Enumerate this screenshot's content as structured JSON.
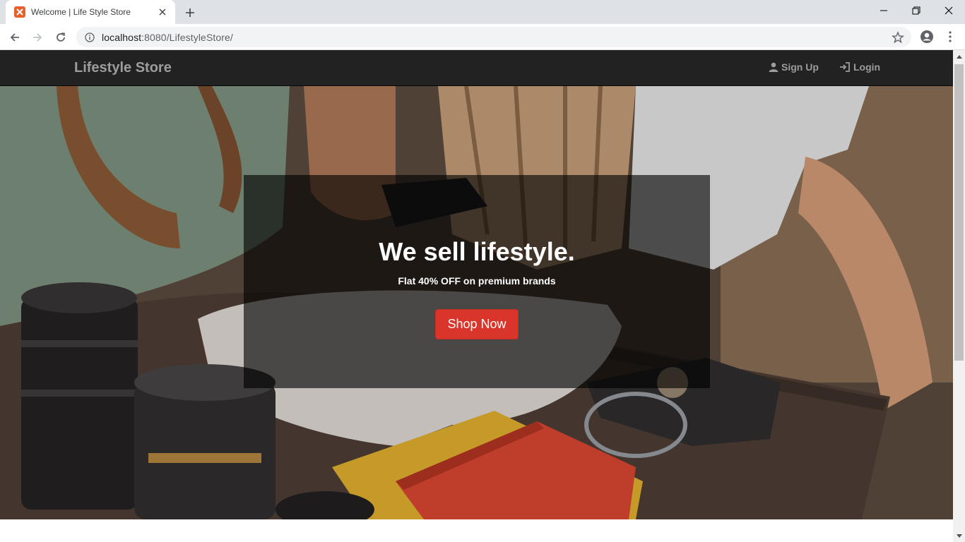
{
  "browser": {
    "tab_title": "Welcome | Life Style Store",
    "url_host": "localhost",
    "url_rest": ":8080/LifestyleStore/"
  },
  "site": {
    "brand": "Lifestyle Store",
    "nav": {
      "signup_label": "Sign Up",
      "login_label": "Login"
    }
  },
  "hero": {
    "headline": "We sell lifestyle.",
    "subheadline": "Flat 40% OFF on premium brands",
    "cta_label": "Shop Now"
  },
  "colors": {
    "navbar_bg": "#222222",
    "brand_text": "#9d9d9d",
    "cta_bg": "#d9352b",
    "overlay": "rgba(0,0,0,0.62)"
  },
  "icons": [
    "xampp-favicon-icon",
    "close-icon",
    "plus-icon",
    "minimize-icon",
    "restore-icon",
    "back-icon",
    "forward-icon",
    "reload-icon",
    "info-icon",
    "star-icon",
    "account-icon",
    "kebab-menu-icon",
    "user-icon",
    "login-icon"
  ]
}
